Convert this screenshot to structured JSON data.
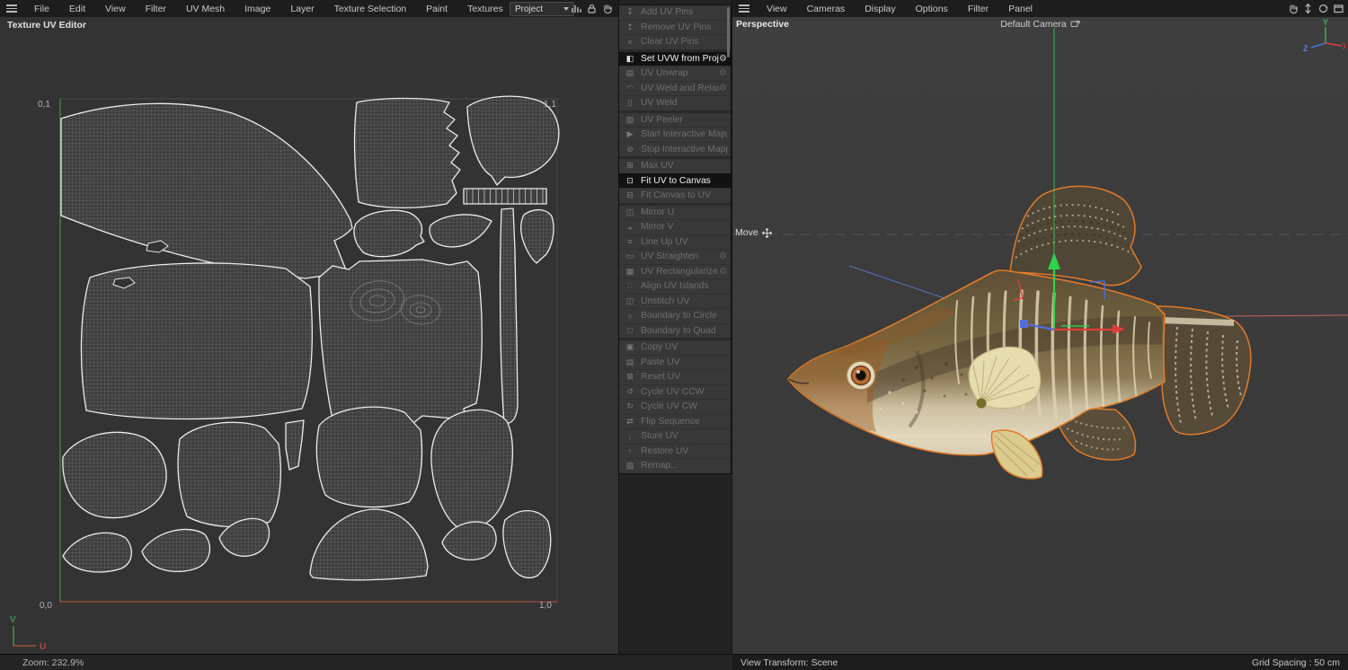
{
  "left": {
    "menubar": [
      "File",
      "Edit",
      "View",
      "Filter",
      "UV Mesh",
      "Image",
      "Layer",
      "Texture Selection",
      "Paint",
      "Textures"
    ],
    "title": "Texture UV Editor",
    "project_label": "Project",
    "corners": {
      "top_left": "0,1",
      "top_right": "1,1",
      "bottom_left": "0,0",
      "bottom_right": "1,0"
    },
    "uv_axes": {
      "u": "U",
      "v": "V"
    },
    "status_zoom": "Zoom: 232.9%"
  },
  "tool_menu": {
    "groups": [
      {
        "items": [
          {
            "label": "Add UV Pins",
            "icon_glyph": "↧",
            "icon_name": "pin-add-icon",
            "enabled": false,
            "gear": false
          },
          {
            "label": "Remove UV Pins",
            "icon_glyph": "↥",
            "icon_name": "pin-remove-icon",
            "enabled": false,
            "gear": false
          },
          {
            "label": "Clear UV Pins",
            "icon_glyph": "×",
            "icon_name": "clear-icon",
            "enabled": false,
            "gear": false
          }
        ]
      },
      {
        "items": [
          {
            "label": "Set UVW from Projection",
            "icon_glyph": "◧",
            "icon_name": "projection-icon",
            "enabled": true,
            "gear": true
          },
          {
            "label": "UV Unwrap",
            "icon_glyph": "▤",
            "icon_name": "unwrap-icon",
            "enabled": false,
            "gear": true
          },
          {
            "label": "UV Weld and Relax",
            "icon_glyph": "◠",
            "icon_name": "weld-relax-icon",
            "enabled": false,
            "gear": true
          },
          {
            "label": "UV Weld",
            "icon_glyph": "▯",
            "icon_name": "weld-icon",
            "enabled": false,
            "gear": false
          }
        ]
      },
      {
        "items": [
          {
            "label": "UV Peeler",
            "icon_glyph": "▧",
            "icon_name": "peeler-icon",
            "enabled": false,
            "gear": false
          },
          {
            "label": "Start Interactive Mapping",
            "icon_glyph": "▶",
            "icon_name": "play-icon",
            "enabled": false,
            "gear": false
          },
          {
            "label": "Stop Interactive Mapping",
            "icon_glyph": "⊘",
            "icon_name": "stop-icon",
            "enabled": false,
            "gear": false
          }
        ]
      },
      {
        "items": [
          {
            "label": "Max UV",
            "icon_glyph": "⊞",
            "icon_name": "max-uv-icon",
            "enabled": false,
            "gear": false
          },
          {
            "label": "Fit UV to Canvas",
            "icon_glyph": "⊡",
            "icon_name": "fit-uv-icon",
            "enabled": true,
            "gear": false
          },
          {
            "label": "Fit Canvas to UV",
            "icon_glyph": "⊟",
            "icon_name": "fit-canvas-icon",
            "enabled": false,
            "gear": false
          }
        ]
      },
      {
        "items": [
          {
            "label": "Mirror U",
            "icon_glyph": "◫",
            "icon_name": "mirror-u-icon",
            "enabled": false,
            "gear": false
          },
          {
            "label": "Mirror V",
            "icon_glyph": "◒",
            "icon_name": "mirror-v-icon",
            "enabled": false,
            "gear": false
          },
          {
            "label": "Line Up UV",
            "icon_glyph": "≡",
            "icon_name": "lineup-icon",
            "enabled": false,
            "gear": false
          },
          {
            "label": "UV Straighten",
            "icon_glyph": "▭",
            "icon_name": "straighten-icon",
            "enabled": false,
            "gear": true
          },
          {
            "label": "UV Rectangularize",
            "icon_glyph": "▦",
            "icon_name": "rectangularize-icon",
            "enabled": false,
            "gear": true
          },
          {
            "label": "Align UV Islands",
            "icon_glyph": "∷",
            "icon_name": "align-islands-icon",
            "enabled": false,
            "gear": false
          },
          {
            "label": "Unstitch UV",
            "icon_glyph": "◫",
            "icon_name": "unstitch-icon",
            "enabled": false,
            "gear": false
          },
          {
            "label": "Boundary to Circle",
            "icon_glyph": "○",
            "icon_name": "boundary-circle-icon",
            "enabled": false,
            "gear": false
          },
          {
            "label": "Boundary to Quad",
            "icon_glyph": "□",
            "icon_name": "boundary-quad-icon",
            "enabled": false,
            "gear": false
          }
        ]
      },
      {
        "items": [
          {
            "label": "Copy UV",
            "icon_glyph": "▣",
            "icon_name": "copy-icon",
            "enabled": false,
            "gear": false
          },
          {
            "label": "Paste UV",
            "icon_glyph": "▤",
            "icon_name": "paste-icon",
            "enabled": false,
            "gear": false
          },
          {
            "label": "Reset UV",
            "icon_glyph": "⊠",
            "icon_name": "reset-icon",
            "enabled": false,
            "gear": false
          },
          {
            "label": "Cycle UV CCW",
            "icon_glyph": "↺",
            "icon_name": "cycle-ccw-icon",
            "enabled": false,
            "gear": false
          },
          {
            "label": "Cycle UV CW",
            "icon_glyph": "↻",
            "icon_name": "cycle-cw-icon",
            "enabled": false,
            "gear": false
          },
          {
            "label": "Flip Sequence",
            "icon_glyph": "⇄",
            "icon_name": "flip-icon",
            "enabled": false,
            "gear": false
          },
          {
            "label": "Store UV",
            "icon_glyph": "↓",
            "icon_name": "store-icon",
            "enabled": false,
            "gear": false
          },
          {
            "label": "Restore UV",
            "icon_glyph": "↑",
            "icon_name": "restore-icon",
            "enabled": false,
            "gear": false
          },
          {
            "label": "Remap...",
            "icon_glyph": "▨",
            "icon_name": "remap-icon",
            "enabled": false,
            "gear": false
          }
        ]
      }
    ]
  },
  "viewport": {
    "menubar": [
      "View",
      "Cameras",
      "Display",
      "Options",
      "Filter",
      "Panel"
    ],
    "view_label": "Perspective",
    "camera_label": "Default Camera",
    "tool_label": "Move",
    "status_left": "View Transform: Scene",
    "status_right": "Grid Spacing : 50 cm",
    "axes": {
      "x": "X",
      "y": "Y",
      "z": "Z"
    }
  },
  "colors": {
    "selection_orange": "#e07b2a",
    "axis_x_red": "#e03c3c",
    "axis_y_green": "#3fae57",
    "axis_z_blue": "#4f6fe0",
    "uv_wire": "#ececec",
    "uv_u_axis_red": "#a04f3f",
    "uv_v_axis_green": "#4c8f52"
  }
}
